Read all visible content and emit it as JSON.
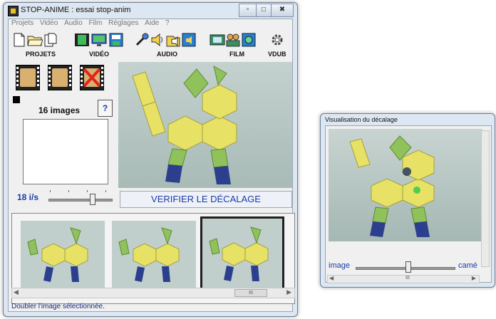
{
  "main_window": {
    "title": "STOP-ANIME : essai stop-anim",
    "menu": [
      "Projets",
      "Vidéo",
      "Audio",
      "Film",
      "Réglages",
      "Aide",
      "?"
    ],
    "toolbar_groups": [
      "PROJETS",
      "VIDÉO",
      "AUDIO",
      "FILM",
      "VDUB"
    ],
    "images_count": "16 images",
    "help_label": "?",
    "fps_label": "18 i/s",
    "verify_button": "VERIFIER LE DÉCALAGE",
    "status_text": "Doubler l'image sélectionnée.",
    "scrollbar_grip": "III"
  },
  "vis_window": {
    "title": "Visualisation du décalage",
    "image_label": "image",
    "camera_label": "camé",
    "scrollbar_grip": "III"
  },
  "colors": {
    "accent_text": "#1a3aa8",
    "frame_border": "#202020",
    "shape_yellow": "#e7e165",
    "shape_green": "#8fc25a",
    "shape_blue": "#2c3f8e"
  }
}
